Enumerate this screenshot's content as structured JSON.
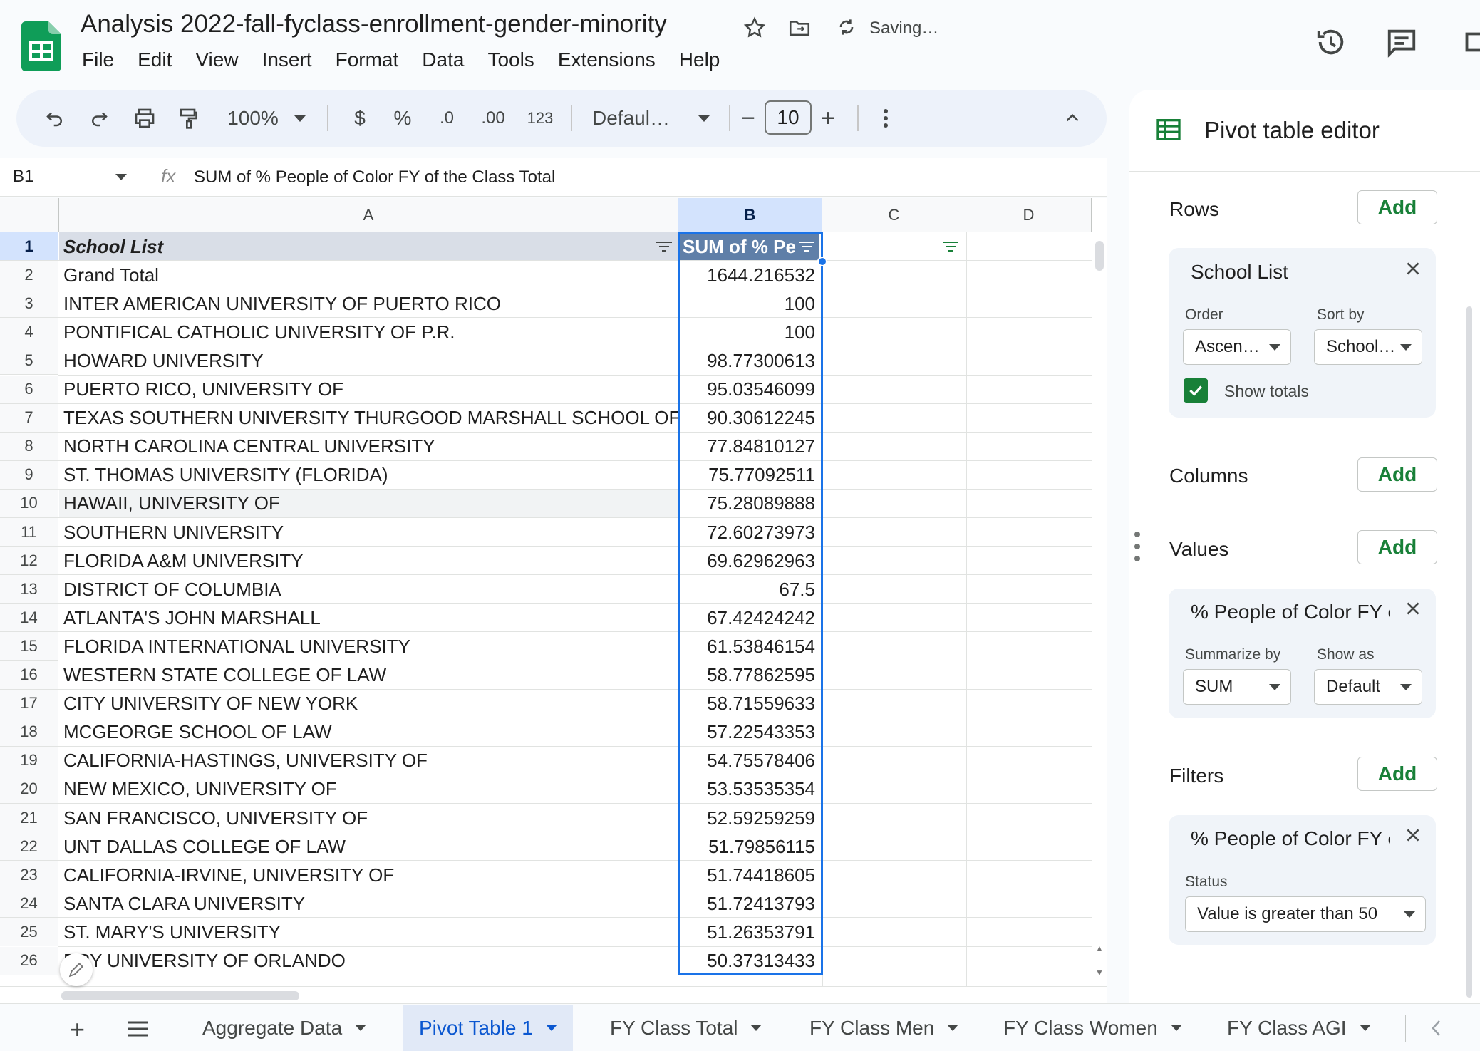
{
  "doc": {
    "title": "Analysis 2022-fall-fyclass-enrollment-gender-minority",
    "saving": "Saving…",
    "menu": [
      "File",
      "Edit",
      "View",
      "Insert",
      "Format",
      "Data",
      "Tools",
      "Extensions",
      "Help"
    ]
  },
  "toolbar": {
    "zoom": "100%",
    "currency": "$",
    "percent": "%",
    "dec_decrease": ".0",
    "dec_increase": ".00",
    "number_format": "123",
    "font": "Defaul…",
    "minus": "−",
    "font_size": "10",
    "plus": "+"
  },
  "formula_bar": {
    "cell_ref": "B1",
    "fx": "fx",
    "formula": "SUM of % People of Color FY of the Class Total"
  },
  "grid": {
    "columns": [
      "A",
      "B",
      "C",
      "D"
    ],
    "header_row": {
      "a": "School List",
      "b": "SUM of % Pe"
    },
    "rows": [
      {
        "n": "1"
      },
      {
        "n": "2",
        "a": "Grand Total",
        "b": "1644.216532"
      },
      {
        "n": "3",
        "a": "INTER AMERICAN UNIVERSITY OF PUERTO RICO",
        "b": "100"
      },
      {
        "n": "4",
        "a": "PONTIFICAL CATHOLIC UNIVERSITY OF P.R.",
        "b": "100"
      },
      {
        "n": "5",
        "a": "HOWARD UNIVERSITY",
        "b": "98.77300613"
      },
      {
        "n": "6",
        "a": "PUERTO RICO, UNIVERSITY OF",
        "b": "95.03546099"
      },
      {
        "n": "7",
        "a": "TEXAS SOUTHERN UNIVERSITY THURGOOD MARSHALL SCHOOL OF LAW",
        "b": "90.30612245"
      },
      {
        "n": "8",
        "a": "NORTH CAROLINA CENTRAL UNIVERSITY",
        "b": "77.84810127"
      },
      {
        "n": "9",
        "a": "ST. THOMAS UNIVERSITY (FLORIDA)",
        "b": "75.77092511"
      },
      {
        "n": "10",
        "a": "HAWAII, UNIVERSITY OF",
        "b": "75.28089888"
      },
      {
        "n": "11",
        "a": "SOUTHERN UNIVERSITY",
        "b": "72.60273973"
      },
      {
        "n": "12",
        "a": "FLORIDA A&M UNIVERSITY",
        "b": "69.62962963"
      },
      {
        "n": "13",
        "a": "DISTRICT OF COLUMBIA",
        "b": "67.5"
      },
      {
        "n": "14",
        "a": "ATLANTA'S JOHN MARSHALL",
        "b": "67.42424242"
      },
      {
        "n": "15",
        "a": "FLORIDA INTERNATIONAL UNIVERSITY",
        "b": "61.53846154"
      },
      {
        "n": "16",
        "a": "WESTERN STATE COLLEGE OF LAW",
        "b": "58.77862595"
      },
      {
        "n": "17",
        "a": "CITY UNIVERSITY OF NEW YORK",
        "b": "58.71559633"
      },
      {
        "n": "18",
        "a": "MCGEORGE SCHOOL OF LAW",
        "b": "57.22543353"
      },
      {
        "n": "19",
        "a": "CALIFORNIA-HASTINGS, UNIVERSITY OF",
        "b": "54.75578406"
      },
      {
        "n": "20",
        "a": "NEW MEXICO, UNIVERSITY OF",
        "b": "53.53535354"
      },
      {
        "n": "21",
        "a": "SAN FRANCISCO, UNIVERSITY OF",
        "b": "52.59259259"
      },
      {
        "n": "22",
        "a": "UNT DALLAS COLLEGE OF LAW",
        "b": "51.79856115"
      },
      {
        "n": "23",
        "a": "CALIFORNIA-IRVINE, UNIVERSITY OF",
        "b": "51.74418605"
      },
      {
        "n": "24",
        "a": "SANTA CLARA UNIVERSITY",
        "b": "51.72413793"
      },
      {
        "n": "25",
        "a": "ST. MARY'S UNIVERSITY",
        "b": "51.26353791"
      },
      {
        "n": "26",
        "a": "RRY UNIVERSITY OF ORLANDO",
        "b": "50.37313433"
      }
    ]
  },
  "pivot_editor": {
    "title": "Pivot table editor",
    "add_label": "Add",
    "rows": {
      "label": "Rows",
      "card_title": "School List",
      "order_label": "Order",
      "order_value": "Ascen…",
      "sortby_label": "Sort by",
      "sortby_value": "School…",
      "show_totals": "Show totals"
    },
    "columns": {
      "label": "Columns"
    },
    "values": {
      "label": "Values",
      "card_title": "% People of Color FY of the Class Total",
      "summarize_label": "Summarize by",
      "summarize_value": "SUM",
      "showas_label": "Show as",
      "showas_value": "Default"
    },
    "filters": {
      "label": "Filters",
      "card_title": "% People of Color FY of the Class Total",
      "status_label": "Status",
      "status_value": "Value is greater than 50"
    }
  },
  "sheets": {
    "tabs": [
      "Aggregate Data",
      "Pivot Table 1",
      "FY Class Total",
      "FY Class Men",
      "FY Class Women",
      "FY Class AGI"
    ],
    "active": "Pivot Table 1"
  },
  "colors": {
    "accent": "#0b57d0",
    "sheets_green": "#188038",
    "selected_col": "#d3e3fd"
  }
}
